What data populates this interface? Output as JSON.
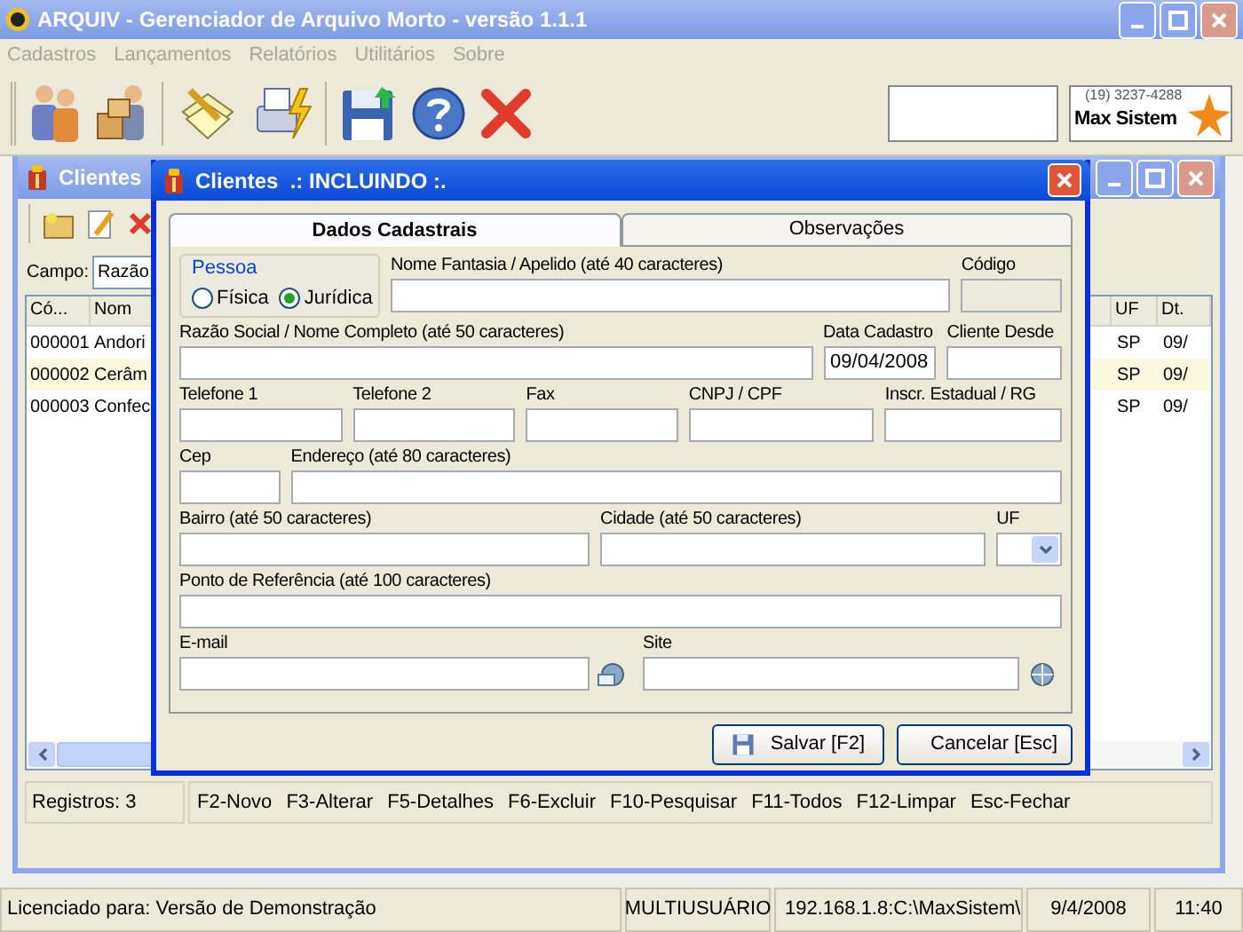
{
  "app": {
    "title": "ARQUIV - Gerenciador de Arquivo Morto - versão 1.1.1"
  },
  "menu": [
    {
      "label": "Cadastros",
      "disabled": true
    },
    {
      "label": "Lançamentos",
      "disabled": true
    },
    {
      "label": "Relatórios",
      "disabled": true
    },
    {
      "label": "Utilitários",
      "disabled": true
    },
    {
      "label": "Sobre",
      "disabled": true
    }
  ],
  "logo": {
    "phone": "(19) 3237-4288",
    "name": "Max Sistem"
  },
  "clientes_window": {
    "title": "Clientes",
    "campo_label": "Campo:",
    "campo_value": "Razão",
    "columns": [
      "Có...",
      "Nom",
      "UF",
      "Dt."
    ],
    "rows": [
      {
        "code": "000001",
        "name": "Andori",
        "uf": "SP",
        "date": "09/",
        "selected": false
      },
      {
        "code": "000002",
        "name": "Cerâm",
        "uf": "SP",
        "date": "09/",
        "selected": true
      },
      {
        "code": "000003",
        "name": "Confec",
        "uf": "SP",
        "date": "09/",
        "selected": false
      }
    ],
    "count": "Registros: 3",
    "shortcuts": [
      "F2-Novo",
      "F3-Alterar",
      "F5-Detalhes",
      "F6-Excluir",
      "F10-Pesquisar",
      "F11-Todos",
      "F12-Limpar",
      "Esc-Fechar"
    ]
  },
  "dialog": {
    "title": "Clientes  .: INCLUINDO :.",
    "tabs": [
      {
        "label": "Dados Cadastrais",
        "selected": true
      },
      {
        "label": "Observações",
        "selected": false
      }
    ],
    "fields": [
      [
        {
          "kind": "radios",
          "label": "Pessoa",
          "options": [
            {
              "label": "Física",
              "selected": false
            },
            {
              "label": "Jurídica",
              "selected": true
            }
          ]
        },
        {
          "kind": "text",
          "label": "Nome Fantasia / Apelido (até 40 caracteres)",
          "disabled": false
        },
        {
          "kind": "text",
          "label": "Código",
          "disabled": true
        }
      ],
      [
        {
          "kind": "text",
          "label": "Razão Social / Nome Completo (até 50 caracteres)",
          "disabled": false
        },
        {
          "kind": "text",
          "label": "Data Cadastro",
          "value": "09/04/2008",
          "disabled": false
        },
        {
          "kind": "text",
          "label": "Cliente Desde",
          "disabled": false
        }
      ],
      [
        {
          "kind": "text",
          "label": "Telefone 1",
          "disabled": false
        },
        {
          "kind": "text",
          "label": "Telefone 2",
          "disabled": false
        },
        {
          "kind": "text",
          "label": "Fax",
          "disabled": false
        },
        {
          "kind": "text",
          "label": "CNPJ / CPF",
          "disabled": false
        },
        {
          "kind": "text",
          "label": "Inscr. Estadual / RG",
          "disabled": false
        }
      ],
      [
        {
          "kind": "text",
          "label": "Cep",
          "disabled": false
        },
        {
          "kind": "text",
          "label": "Endereço (até 80 caracteres)",
          "disabled": false
        }
      ],
      [
        {
          "kind": "text",
          "label": "Bairro (até 50 caracteres)",
          "disabled": false
        },
        {
          "kind": "text",
          "label": "Cidade (até 50 caracteres)",
          "disabled": false
        },
        {
          "kind": "select",
          "label": "UF",
          "disabled": false
        }
      ],
      [
        {
          "kind": "text",
          "label": "Ponto de Referência (até 100 caracteres)",
          "disabled": false
        }
      ],
      [
        {
          "kind": "email",
          "label": "E-mail",
          "disabled": false
        },
        {
          "kind": "web",
          "label": "Site",
          "disabled": false
        }
      ]
    ],
    "buttons": [
      {
        "kind": "save",
        "label": "Salvar [F2]"
      },
      {
        "kind": "cancel",
        "label": "Cancelar [Esc]"
      }
    ]
  },
  "status_bar": {
    "license": "Licenciado para: Versão de Demonstração",
    "mode": "MULTIUSUÁRIO",
    "path": "192.168.1.8:C:\\MaxSistem\\",
    "date": "9/4/2008",
    "time": "11:40"
  }
}
